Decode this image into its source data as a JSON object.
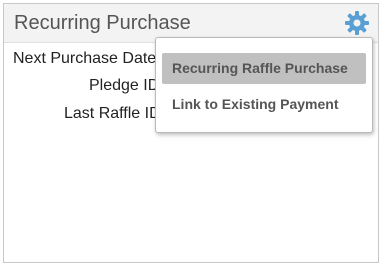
{
  "panel": {
    "title": "Recurring Purchase",
    "settings_icon": "gear-icon",
    "fields": [
      {
        "label": "Next Purchase Date"
      },
      {
        "label": "Pledge ID"
      },
      {
        "label": "Last Raffle ID"
      }
    ]
  },
  "menu": {
    "items": [
      {
        "label": "Recurring Raffle Purchase",
        "highlighted": true
      },
      {
        "label": "Link to Existing Payment",
        "highlighted": false
      }
    ]
  },
  "colors": {
    "accent_icon": "#5a9fd4",
    "header_bg": "#f3f3f3",
    "highlight_bg": "#c0c0c0"
  }
}
